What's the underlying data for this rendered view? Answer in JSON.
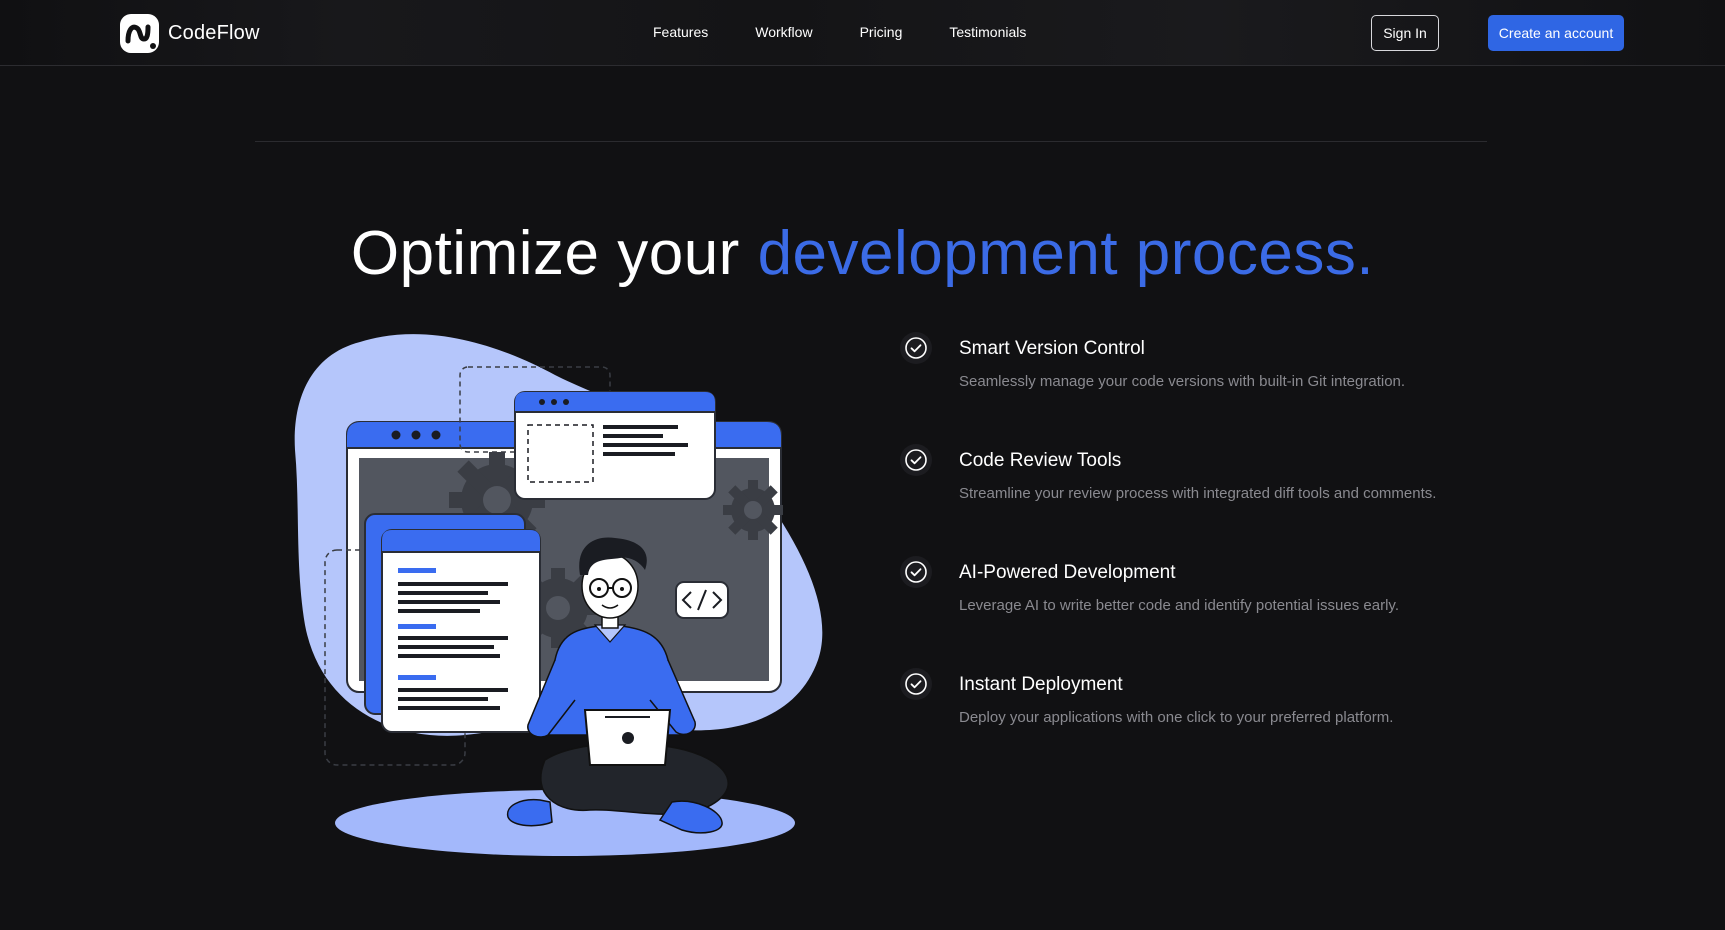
{
  "brand": {
    "name": "CodeFlow",
    "logo_icon": "codeflow-logo-icon",
    "accent_color": "#2f66e4"
  },
  "nav": {
    "links": [
      {
        "label": "Features"
      },
      {
        "label": "Workflow"
      },
      {
        "label": "Pricing"
      },
      {
        "label": "Testimonials"
      }
    ],
    "sign_in_label": "Sign In",
    "create_account_label": "Create an account"
  },
  "hero": {
    "headline_start": "Optimize your",
    "headline_accent": "development process.",
    "headline_accent_color": "#3b6be6",
    "illustration_icon": "developer-illustration"
  },
  "features": [
    {
      "icon": "check-circle-icon",
      "title": "Smart Version Control",
      "description": "Seamlessly manage your code versions with built-in Git integration."
    },
    {
      "icon": "check-circle-icon",
      "title": "Code Review Tools",
      "description": "Streamline your review process with integrated diff tools and comments."
    },
    {
      "icon": "check-circle-icon",
      "title": "AI-Powered Development",
      "description": "Leverage AI to write better code and identify potential issues early."
    },
    {
      "icon": "check-circle-icon",
      "title": "Instant Deployment",
      "description": "Deploy your applications with one click to your preferred platform."
    }
  ]
}
